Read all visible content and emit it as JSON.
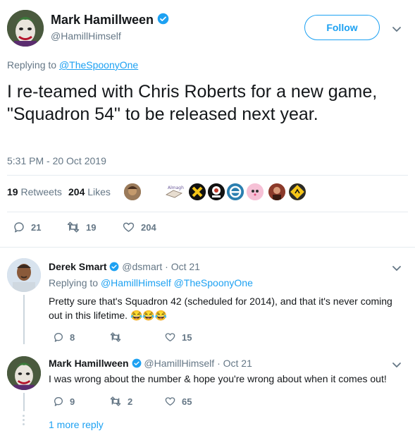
{
  "main_tweet": {
    "author_name": "Mark Hamillween",
    "author_handle": "@HamillHimself",
    "follow_label": "Follow",
    "replying_prefix": "Replying to",
    "replying_to": "@TheSpoonyOne",
    "text": "I re-teamed with Chris Roberts for a new game, \"Squadron 54\" to be released next year.",
    "timestamp": "5:31 PM - 20 Oct 2019",
    "retweets_count": "19",
    "retweets_label": "Retweets",
    "likes_count": "204",
    "likes_label": "Likes",
    "reply_count": "21",
    "retweet_action_count": "19",
    "like_action_count": "204"
  },
  "replies": [
    {
      "author_name": "Derek Smart",
      "author_handle": "@dsmart",
      "date": "· Oct 21",
      "replying_prefix": "Replying to",
      "replying_to": "@HamillHimself @TheSpoonyOne",
      "text_line1": "Pretty sure that's Squadron 42 (scheduled for 2014), and that it's never coming",
      "text_line2": "out in this lifetime.",
      "emoji": "😂😂😂",
      "reply_count": "8",
      "retweet_count": "",
      "like_count": "15"
    },
    {
      "author_name": "Mark Hamillween",
      "author_handle": "@HamillHimself",
      "date": "· Oct 21",
      "text": "I was wrong about the number & hope you're wrong about when it comes out!",
      "reply_count": "9",
      "retweet_count": "2",
      "like_count": "65"
    }
  ],
  "more_replies_label": "1 more reply",
  "colors": {
    "accent": "#1da1f2",
    "muted": "#657786",
    "divider": "#e6ecf0",
    "thread_line": "#ccd6dd"
  }
}
